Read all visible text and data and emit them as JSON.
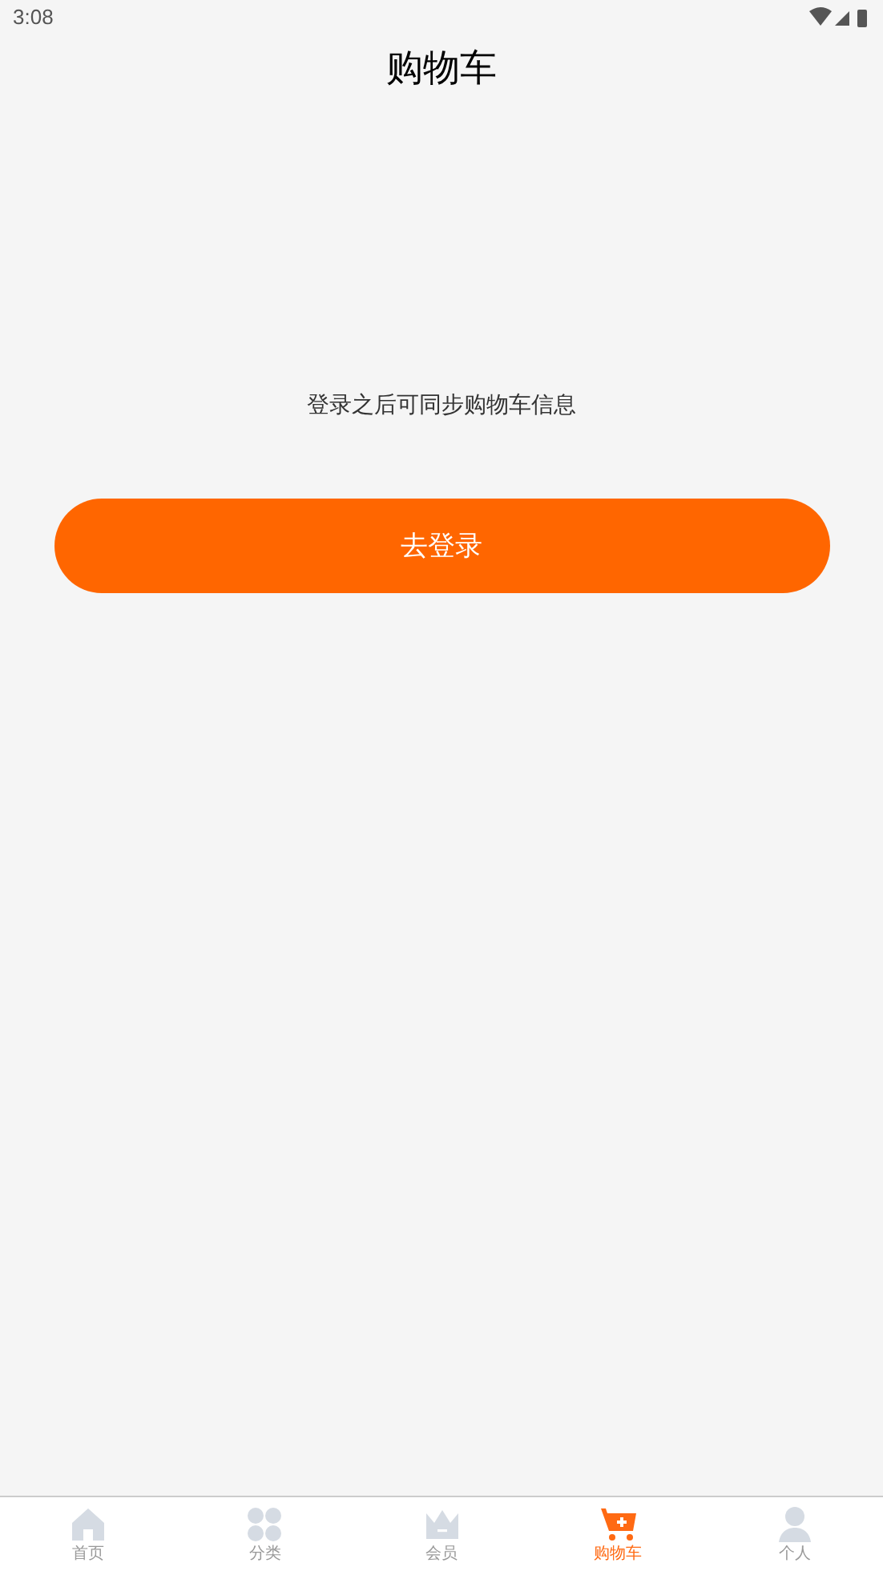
{
  "status_bar": {
    "time": "3:08"
  },
  "header": {
    "title": "购物车"
  },
  "empty_state": {
    "message": "登录之后可同步购物车信息",
    "button": "去登录"
  },
  "bottom_nav": [
    {
      "label": "首页",
      "selected": false
    },
    {
      "label": "分类",
      "selected": false
    },
    {
      "label": "会员",
      "selected": false
    },
    {
      "label": "购物车",
      "selected": true
    },
    {
      "label": "个人",
      "selected": false
    }
  ]
}
